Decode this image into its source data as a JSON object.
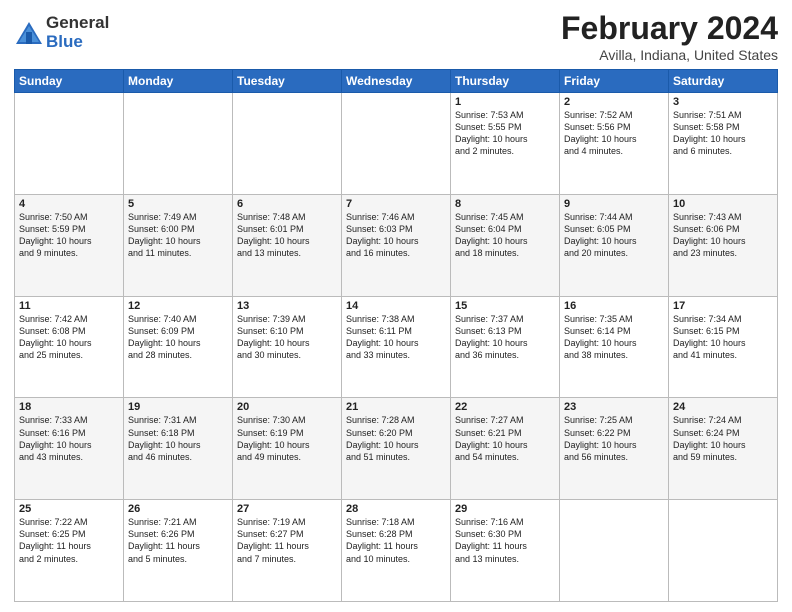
{
  "logo": {
    "general": "General",
    "blue": "Blue"
  },
  "title": "February 2024",
  "subtitle": "Avilla, Indiana, United States",
  "days_header": [
    "Sunday",
    "Monday",
    "Tuesday",
    "Wednesday",
    "Thursday",
    "Friday",
    "Saturday"
  ],
  "weeks": [
    [
      {
        "day": "",
        "detail": ""
      },
      {
        "day": "",
        "detail": ""
      },
      {
        "day": "",
        "detail": ""
      },
      {
        "day": "",
        "detail": ""
      },
      {
        "day": "1",
        "detail": "Sunrise: 7:53 AM\nSunset: 5:55 PM\nDaylight: 10 hours\nand 2 minutes."
      },
      {
        "day": "2",
        "detail": "Sunrise: 7:52 AM\nSunset: 5:56 PM\nDaylight: 10 hours\nand 4 minutes."
      },
      {
        "day": "3",
        "detail": "Sunrise: 7:51 AM\nSunset: 5:58 PM\nDaylight: 10 hours\nand 6 minutes."
      }
    ],
    [
      {
        "day": "4",
        "detail": "Sunrise: 7:50 AM\nSunset: 5:59 PM\nDaylight: 10 hours\nand 9 minutes."
      },
      {
        "day": "5",
        "detail": "Sunrise: 7:49 AM\nSunset: 6:00 PM\nDaylight: 10 hours\nand 11 minutes."
      },
      {
        "day": "6",
        "detail": "Sunrise: 7:48 AM\nSunset: 6:01 PM\nDaylight: 10 hours\nand 13 minutes."
      },
      {
        "day": "7",
        "detail": "Sunrise: 7:46 AM\nSunset: 6:03 PM\nDaylight: 10 hours\nand 16 minutes."
      },
      {
        "day": "8",
        "detail": "Sunrise: 7:45 AM\nSunset: 6:04 PM\nDaylight: 10 hours\nand 18 minutes."
      },
      {
        "day": "9",
        "detail": "Sunrise: 7:44 AM\nSunset: 6:05 PM\nDaylight: 10 hours\nand 20 minutes."
      },
      {
        "day": "10",
        "detail": "Sunrise: 7:43 AM\nSunset: 6:06 PM\nDaylight: 10 hours\nand 23 minutes."
      }
    ],
    [
      {
        "day": "11",
        "detail": "Sunrise: 7:42 AM\nSunset: 6:08 PM\nDaylight: 10 hours\nand 25 minutes."
      },
      {
        "day": "12",
        "detail": "Sunrise: 7:40 AM\nSunset: 6:09 PM\nDaylight: 10 hours\nand 28 minutes."
      },
      {
        "day": "13",
        "detail": "Sunrise: 7:39 AM\nSunset: 6:10 PM\nDaylight: 10 hours\nand 30 minutes."
      },
      {
        "day": "14",
        "detail": "Sunrise: 7:38 AM\nSunset: 6:11 PM\nDaylight: 10 hours\nand 33 minutes."
      },
      {
        "day": "15",
        "detail": "Sunrise: 7:37 AM\nSunset: 6:13 PM\nDaylight: 10 hours\nand 36 minutes."
      },
      {
        "day": "16",
        "detail": "Sunrise: 7:35 AM\nSunset: 6:14 PM\nDaylight: 10 hours\nand 38 minutes."
      },
      {
        "day": "17",
        "detail": "Sunrise: 7:34 AM\nSunset: 6:15 PM\nDaylight: 10 hours\nand 41 minutes."
      }
    ],
    [
      {
        "day": "18",
        "detail": "Sunrise: 7:33 AM\nSunset: 6:16 PM\nDaylight: 10 hours\nand 43 minutes."
      },
      {
        "day": "19",
        "detail": "Sunrise: 7:31 AM\nSunset: 6:18 PM\nDaylight: 10 hours\nand 46 minutes."
      },
      {
        "day": "20",
        "detail": "Sunrise: 7:30 AM\nSunset: 6:19 PM\nDaylight: 10 hours\nand 49 minutes."
      },
      {
        "day": "21",
        "detail": "Sunrise: 7:28 AM\nSunset: 6:20 PM\nDaylight: 10 hours\nand 51 minutes."
      },
      {
        "day": "22",
        "detail": "Sunrise: 7:27 AM\nSunset: 6:21 PM\nDaylight: 10 hours\nand 54 minutes."
      },
      {
        "day": "23",
        "detail": "Sunrise: 7:25 AM\nSunset: 6:22 PM\nDaylight: 10 hours\nand 56 minutes."
      },
      {
        "day": "24",
        "detail": "Sunrise: 7:24 AM\nSunset: 6:24 PM\nDaylight: 10 hours\nand 59 minutes."
      }
    ],
    [
      {
        "day": "25",
        "detail": "Sunrise: 7:22 AM\nSunset: 6:25 PM\nDaylight: 11 hours\nand 2 minutes."
      },
      {
        "day": "26",
        "detail": "Sunrise: 7:21 AM\nSunset: 6:26 PM\nDaylight: 11 hours\nand 5 minutes."
      },
      {
        "day": "27",
        "detail": "Sunrise: 7:19 AM\nSunset: 6:27 PM\nDaylight: 11 hours\nand 7 minutes."
      },
      {
        "day": "28",
        "detail": "Sunrise: 7:18 AM\nSunset: 6:28 PM\nDaylight: 11 hours\nand 10 minutes."
      },
      {
        "day": "29",
        "detail": "Sunrise: 7:16 AM\nSunset: 6:30 PM\nDaylight: 11 hours\nand 13 minutes."
      },
      {
        "day": "",
        "detail": ""
      },
      {
        "day": "",
        "detail": ""
      }
    ]
  ]
}
